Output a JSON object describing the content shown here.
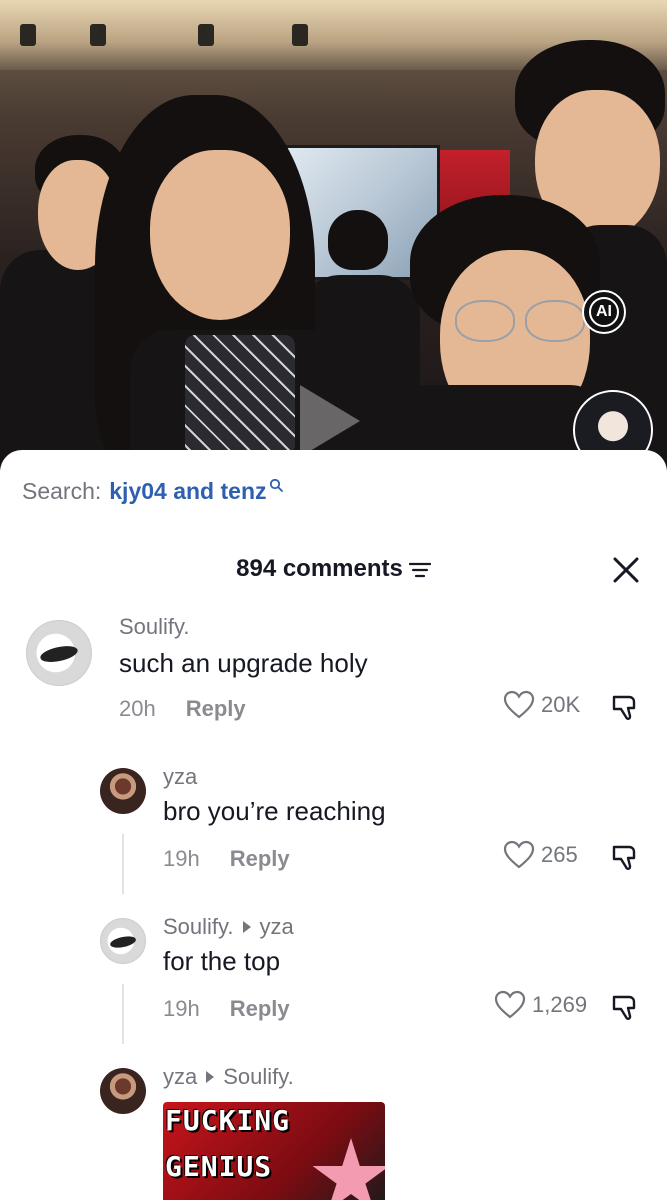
{
  "video": {
    "ai_badge": "AI"
  },
  "search": {
    "prefix": "Search:",
    "term": "kjy04 and tenz"
  },
  "header": {
    "count_label": "894 comments"
  },
  "comments": [
    {
      "username": "Soulify.",
      "text": "such an upgrade holy",
      "time": "20h",
      "reply_label": "Reply",
      "likes": "20K"
    },
    {
      "username": "yza",
      "text": "bro you’re reaching",
      "time": "19h",
      "reply_label": "Reply",
      "likes": "265"
    },
    {
      "username": "Soulify.",
      "reply_to": "yza",
      "text": "for the top",
      "time": "19h",
      "reply_label": "Reply",
      "likes": "1,269"
    },
    {
      "username": "yza",
      "reply_to": "Soulify.",
      "meme_line1": "FUCKING",
      "meme_line2": "GENIUS"
    }
  ],
  "colors": {
    "search_term": "#2f5fb0",
    "muted_text": "#73757c",
    "primary_text": "#161823"
  },
  "icons": [
    "search-icon",
    "filter-icon",
    "close-icon",
    "heart-icon",
    "dislike-icon",
    "arrow-right-icon",
    "play-icon"
  ]
}
